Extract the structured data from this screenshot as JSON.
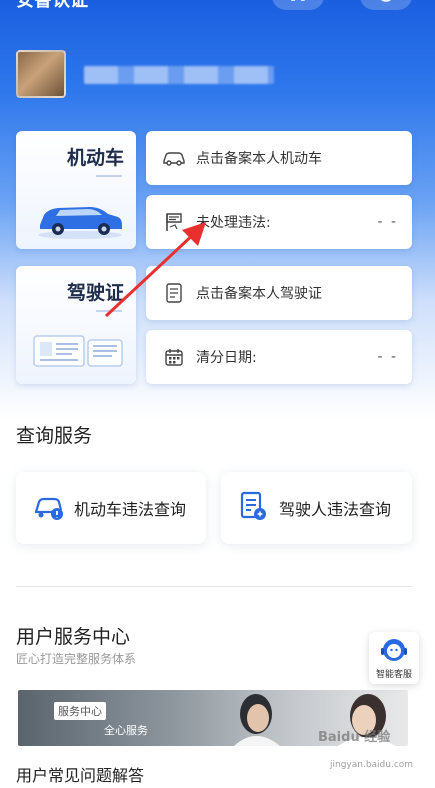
{
  "header": {
    "title": "安鲁认证",
    "scan_icon": "scan-icon",
    "menu_icon": "menu-icon"
  },
  "user": {
    "avatar": "avatar",
    "name_masked": ""
  },
  "vehicle_card": {
    "title": "机动车",
    "register_label": "点击备案本人机动车",
    "violations_label": "未处理违法:",
    "violations_value": "- -"
  },
  "license_card": {
    "title": "驾驶证",
    "register_label": "点击备案本人驾驶证",
    "clear_date_label": "清分日期:",
    "clear_date_value": "- -"
  },
  "query_services": {
    "title": "查询服务",
    "items": [
      {
        "label": "机动车违法查询",
        "icon": "car-violation-icon"
      },
      {
        "label": "驾驶人违法查询",
        "icon": "driver-violation-icon"
      }
    ]
  },
  "user_service_center": {
    "title": "用户服务中心",
    "subtitle": "匠心打造完整服务体系",
    "banner_tag": "服务中心",
    "banner_text": "全心服务",
    "faq_title": "用户常见问题解答"
  },
  "customer_service": {
    "label": "智能客服"
  },
  "watermark": {
    "text": "Baidu 经验",
    "sub": "jingyan.baidu.com"
  },
  "colors": {
    "brand_blue": "#1a5fe0",
    "arrow_red": "#e8312f"
  }
}
